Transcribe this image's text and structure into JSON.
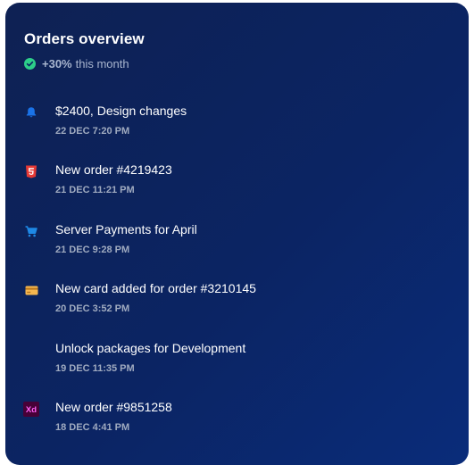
{
  "card": {
    "title": "Orders overview",
    "growth_value": "+30%",
    "growth_period": "this month"
  },
  "timeline": [
    {
      "icon": "bell-icon",
      "text": "$2400, Design changes",
      "time": "22 DEC 7:20 PM",
      "color": "#1a73e8"
    },
    {
      "icon": "html5-icon",
      "text": "New order #4219423",
      "time": "21 DEC 11:21 PM",
      "color": "#e53935"
    },
    {
      "icon": "cart-icon",
      "text": "Server Payments for April",
      "time": "21 DEC 9:28 PM",
      "color": "#1e88e5"
    },
    {
      "icon": "credit-card-icon",
      "text": "New card added for order #3210145",
      "time": "20 DEC 3:52 PM",
      "color": "#f6b74f"
    },
    {
      "icon": "",
      "text": "Unlock packages for Development",
      "time": "19 DEC 11:35 PM",
      "color": ""
    },
    {
      "icon": "adobe-xd-icon",
      "text": "New order #9851258",
      "time": "18 DEC 4:41 PM",
      "color": "#ff2bc2"
    }
  ]
}
